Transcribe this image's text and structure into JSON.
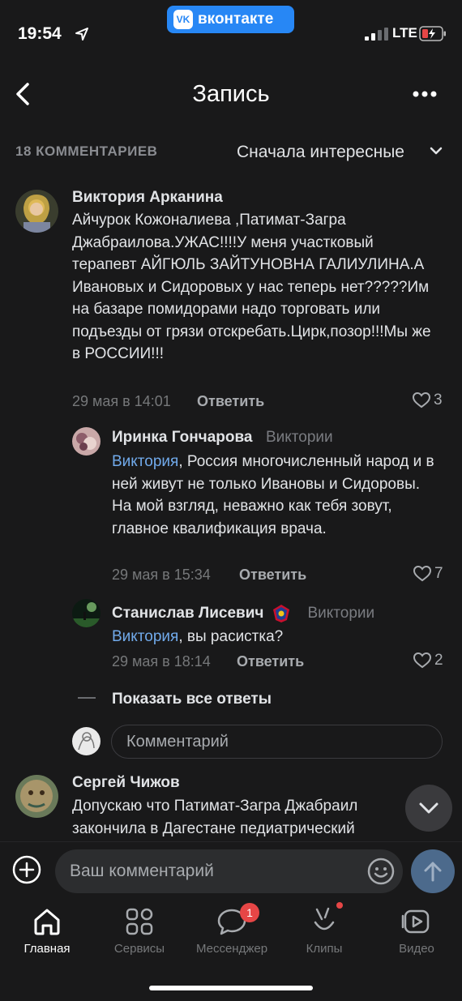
{
  "status": {
    "time": "19:54",
    "network": "LTE",
    "app_pill": "вконтакте",
    "vk_logo": "VK"
  },
  "header": {
    "title": "Запись"
  },
  "sort": {
    "count": "18 КОММЕНТАРИЕВ",
    "mode": "Сначала интересные"
  },
  "comments": [
    {
      "author": "Виктория Арканина",
      "text": "Айчурок Кожоналиева ,Патимат-Загра Джабраилова.УЖАС!!!!У меня участковый терапевт АЙГЮЛЬ ЗАЙТУНОВНА ГАЛИУЛИНА.А Ивановых и Сидоровых у нас теперь нет?????Им на базаре помидорами надо торговать или подъезды от грязи отскребать.Цирк,позор!!!Мы же в РОССИИ!!!",
      "date": "29 мая в 14:01",
      "reply": "Ответить",
      "likes": "3"
    },
    {
      "author": "Иринка Гончарова",
      "reply_to": "Виктории",
      "mention": "Виктория",
      "text": ", Россия многочисленный народ и в ней живут не только Ивановы и Сидоровы. На мой взгляд, неважно как тебя зовут, главное квалификация врача.",
      "date": "29 мая в 15:34",
      "reply": "Ответить",
      "likes": "7"
    },
    {
      "author": "Станислав Лисевич",
      "reply_to": "Виктории",
      "mention": "Виктория",
      "text": ", вы расистка?",
      "date": "29 мая в 18:14",
      "reply": "Ответить",
      "likes": "2"
    },
    {
      "author": "Сергей Чижов",
      "text": "Допускаю что Патимат-Загра Джабраил закончила в Дагестане педиатрический"
    }
  ],
  "show_all": "Показать все ответы",
  "reply_placeholder": "Комментарий",
  "input_placeholder": "Ваш комментарий",
  "tabs": [
    {
      "label": "Главная",
      "icon": "home-icon",
      "active": true
    },
    {
      "label": "Сервисы",
      "icon": "services-icon"
    },
    {
      "label": "Мессенджер",
      "icon": "messenger-icon",
      "badge": "1"
    },
    {
      "label": "Клипы",
      "icon": "clips-icon"
    },
    {
      "label": "Видео",
      "icon": "video-icon"
    }
  ],
  "colors": {
    "background": "#19191a",
    "accent": "#2787f5",
    "mention": "#71aaeb",
    "badge": "#e64646"
  }
}
